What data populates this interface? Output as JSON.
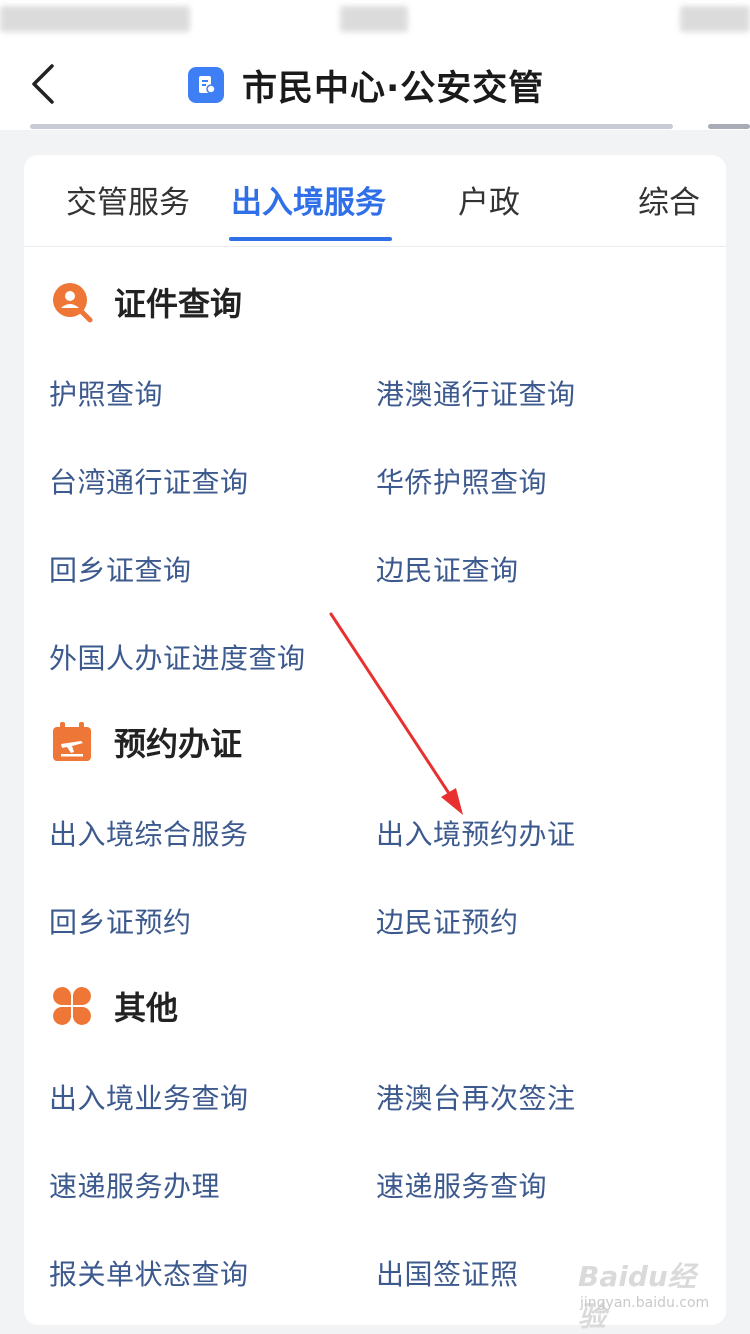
{
  "header": {
    "title": "市民中心·公安交管"
  },
  "tabs": [
    {
      "label": "交管服务"
    },
    {
      "label": "出入境服务"
    },
    {
      "label": "户政"
    },
    {
      "label": "综合"
    }
  ],
  "sections": [
    {
      "title": "证件查询",
      "icon": "person-search-icon",
      "items": [
        "护照查询",
        "港澳通行证查询",
        "台湾通行证查询",
        "华侨护照查询",
        "回乡证查询",
        "边民证查询",
        "外国人办证进度查询"
      ]
    },
    {
      "title": "预约办证",
      "icon": "calendar-plane-icon",
      "items": [
        "出入境综合服务",
        "出入境预约办证",
        "回乡证预约",
        "边民证预约"
      ]
    },
    {
      "title": "其他",
      "icon": "clover-icon",
      "items": [
        "出入境业务查询",
        "港澳台再次签注",
        "速递服务办理",
        "速递服务查询",
        "报关单状态查询",
        "出国签证照"
      ]
    }
  ],
  "watermark": {
    "logo": "Baidu经验",
    "url": "jingyan.baidu.com"
  },
  "colors": {
    "accent": "#2f6fe8",
    "link_text": "#3d5a8f",
    "section_icon": "#ee7636",
    "annotation_arrow": "#e8312f"
  }
}
